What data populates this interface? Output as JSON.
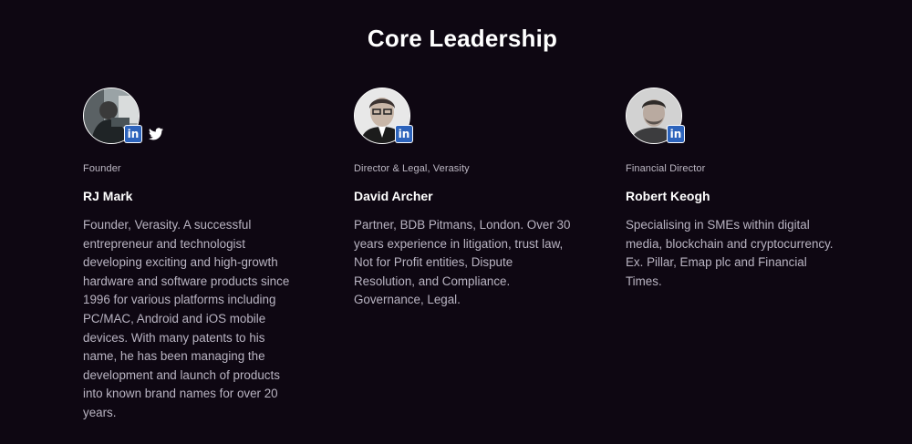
{
  "section": {
    "title": "Core Leadership"
  },
  "members": [
    {
      "role": "Founder",
      "name": "RJ Mark",
      "bio": "Founder, Verasity. A successful entrepreneur and technologist developing exciting and high-growth hardware and software products since 1996 for various platforms including PC/MAC, Android and iOS mobile devices. With many patents to his name, he has been managing the development and launch of products into known brand names for over 20 years.",
      "social": [
        "linkedin-icon",
        "twitter-icon"
      ],
      "linkedin_label": "in"
    },
    {
      "role": "Director & Legal, Verasity",
      "name": "David Archer",
      "bio": "Partner, BDB Pitmans, London. Over 30 years experience in litigation, trust law, Not for Profit entities, Dispute Resolution, and Compliance. Governance, Legal.",
      "social": [
        "linkedin-icon"
      ],
      "linkedin_label": "in"
    },
    {
      "role": "Financial Director",
      "name": "Robert Keogh",
      "bio": "Specialising in SMEs within digital media, blockchain and cryptocurrency. Ex. Pillar, Emap plc and Financial Times.",
      "social": [
        "linkedin-icon"
      ],
      "linkedin_label": "in"
    }
  ],
  "colors": {
    "background": "#0e0712",
    "linkedin": "#2d64bc",
    "text_muted": "#b9b4c2"
  }
}
